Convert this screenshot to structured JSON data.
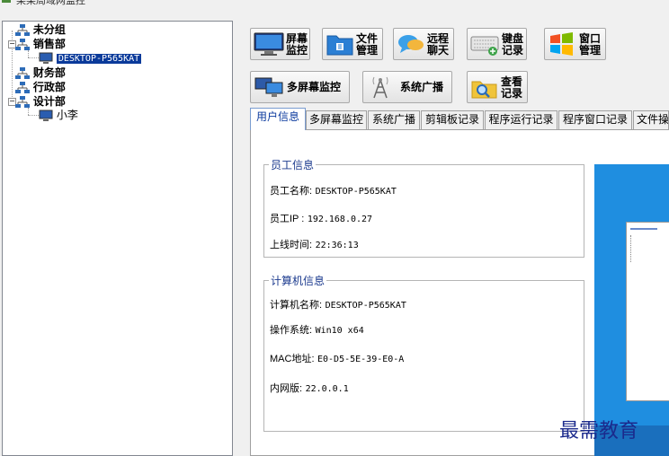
{
  "title": "某某局域网监控",
  "tree": {
    "groups": [
      {
        "label": "未分组"
      },
      {
        "label": "销售部",
        "children": [
          {
            "label": "DESKTOP-P565KAT"
          }
        ]
      },
      {
        "label": "财务部"
      },
      {
        "label": "行政部"
      },
      {
        "label": "设计部",
        "children": [
          {
            "label": "小李"
          }
        ]
      }
    ]
  },
  "toolbar": {
    "screen_monitor": [
      "屏幕",
      "监控"
    ],
    "file_manage": [
      "文件",
      "管理"
    ],
    "remote_chat": [
      "远程",
      "聊天"
    ],
    "keyboard_log": [
      "键盘",
      "记录"
    ],
    "window_manage": [
      "窗口",
      "管理"
    ],
    "multi_screen": "多屏幕监控",
    "broadcast": "系统广播",
    "view_log": [
      "查看",
      "记录"
    ]
  },
  "tabs": [
    "用户信息",
    "多屏幕监控",
    "系统广播",
    "剪辑板记录",
    "程序运行记录",
    "程序窗口记录",
    "文件操"
  ],
  "employee": {
    "title": "员工信息",
    "name_label": "员工名称:",
    "name": "DESKTOP-P565KAT",
    "ip_label": "员工IP :",
    "ip": "192.168.0.27",
    "online_label": "上线时间:",
    "online": "22:36:13"
  },
  "computer": {
    "title": "计算机信息",
    "name_label": "计算机名称:",
    "name": "DESKTOP-P565KAT",
    "os_label": "操作系统:",
    "os": "Win10 x64",
    "mac_label": "MAC地址:",
    "mac": "E0-D5-5E-39-E0-A",
    "lan_label": "内网版:",
    "lan": "22.0.0.1"
  },
  "watermark": "最需教育",
  "colors": {
    "selection": "#0a3a9a",
    "group_title": "#1b3a8e",
    "desktop_blue": "#1f8ee0"
  }
}
